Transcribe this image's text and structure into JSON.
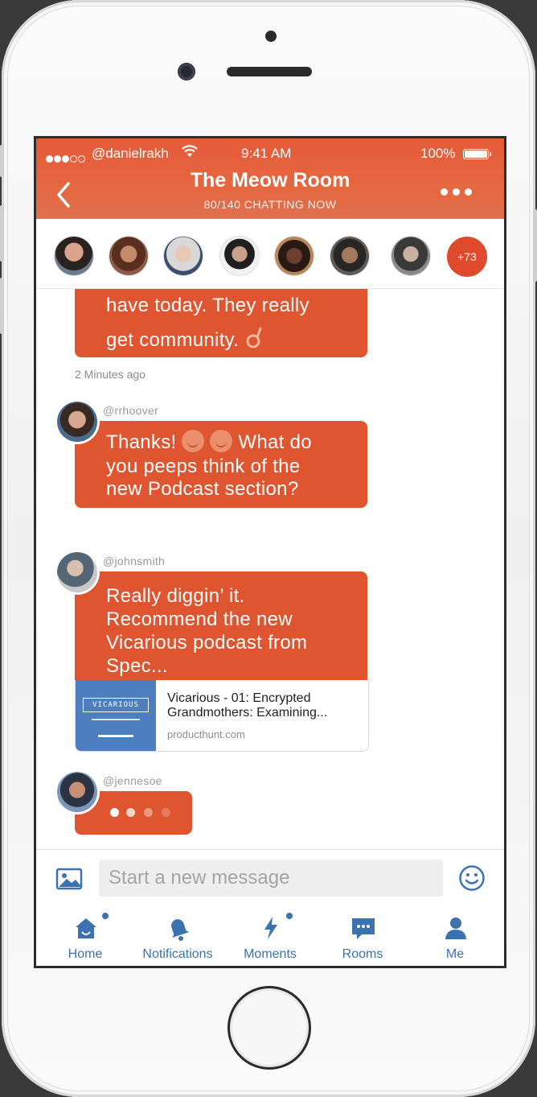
{
  "status_bar": {
    "carrier": "@danielrakh",
    "time": "9:41 AM",
    "battery": "100%"
  },
  "header": {
    "title": "The Meow Room",
    "subtitle": "80/140 CHATTING NOW"
  },
  "participants": {
    "overflow_count": "+73"
  },
  "messages": {
    "m1": {
      "text_line1": "have today. They really",
      "text_line2": "get community.",
      "time": "2 Minutes ago"
    },
    "m2": {
      "handle": "@rrhoover",
      "text_a": "Thanks!",
      "text_b": "What do",
      "text_line2": "you peeps think of the",
      "text_line3": "new Podcast section?"
    },
    "m3": {
      "handle": "@johnsmith",
      "text": "Really diggin’ it. Recommend the new Vicarious podcast from Spec...",
      "link": {
        "thumb_text": "VICARIOUS",
        "title": "Vicarious - 01: Encrypted Grandmothers: Examining...",
        "domain": "producthunt.com"
      }
    },
    "m4": {
      "handle": "@jennesoe"
    }
  },
  "composer": {
    "placeholder": "Start a new message"
  },
  "tabs": {
    "home": "Home",
    "notifications": "Notifications",
    "moments": "Moments",
    "rooms": "Rooms",
    "me": "Me"
  },
  "colors": {
    "accent": "#df5530",
    "tab_blue": "#3d72b0",
    "header": "#e5613b"
  }
}
